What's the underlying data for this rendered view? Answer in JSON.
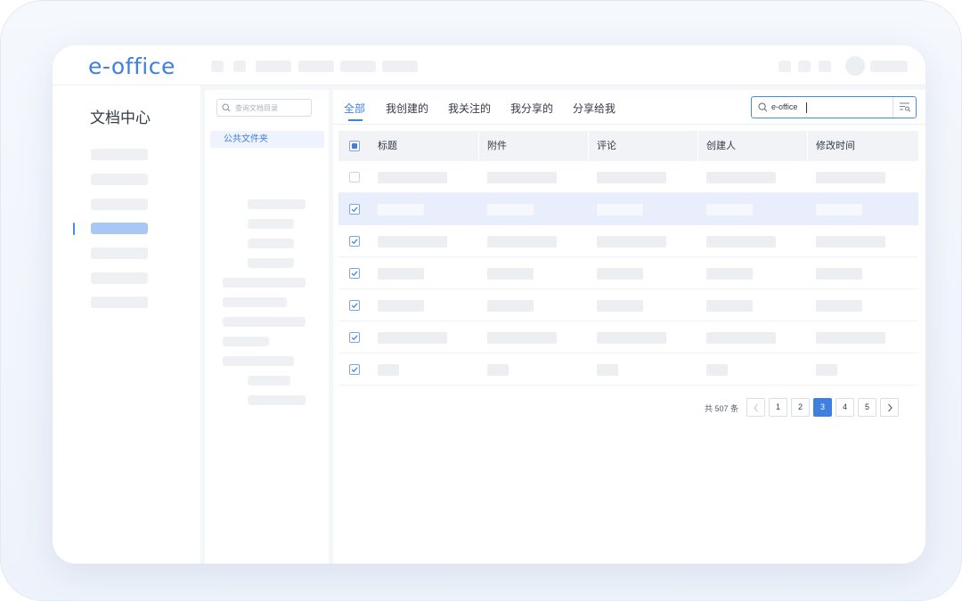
{
  "app": {
    "logo": "e-office"
  },
  "left_nav": {
    "title": "文档中心"
  },
  "tree": {
    "search_placeholder": "查询文档目录",
    "root_folder": "公共文件夹"
  },
  "tabs": [
    {
      "label": "全部",
      "active": true
    },
    {
      "label": "我创建的",
      "active": false
    },
    {
      "label": "我关注的",
      "active": false
    },
    {
      "label": "我分享的",
      "active": false
    },
    {
      "label": "分享给我",
      "active": false
    }
  ],
  "search": {
    "value": "e-office"
  },
  "table": {
    "columns": [
      "标题",
      "附件",
      "评论",
      "创建人",
      "修改时间"
    ],
    "rows": [
      {
        "checked": false,
        "selected": false
      },
      {
        "checked": true,
        "selected": true
      },
      {
        "checked": true,
        "selected": false
      },
      {
        "checked": true,
        "selected": false
      },
      {
        "checked": true,
        "selected": false
      },
      {
        "checked": true,
        "selected": false
      },
      {
        "checked": true,
        "selected": false
      }
    ]
  },
  "pagination": {
    "total_text": "共 507 条",
    "pages": [
      "1",
      "2",
      "3",
      "4",
      "5"
    ],
    "current": "3"
  },
  "colors": {
    "accent": "#3f7fe0",
    "selected_row": "#e8eefc",
    "placeholder": "#eceef2"
  }
}
